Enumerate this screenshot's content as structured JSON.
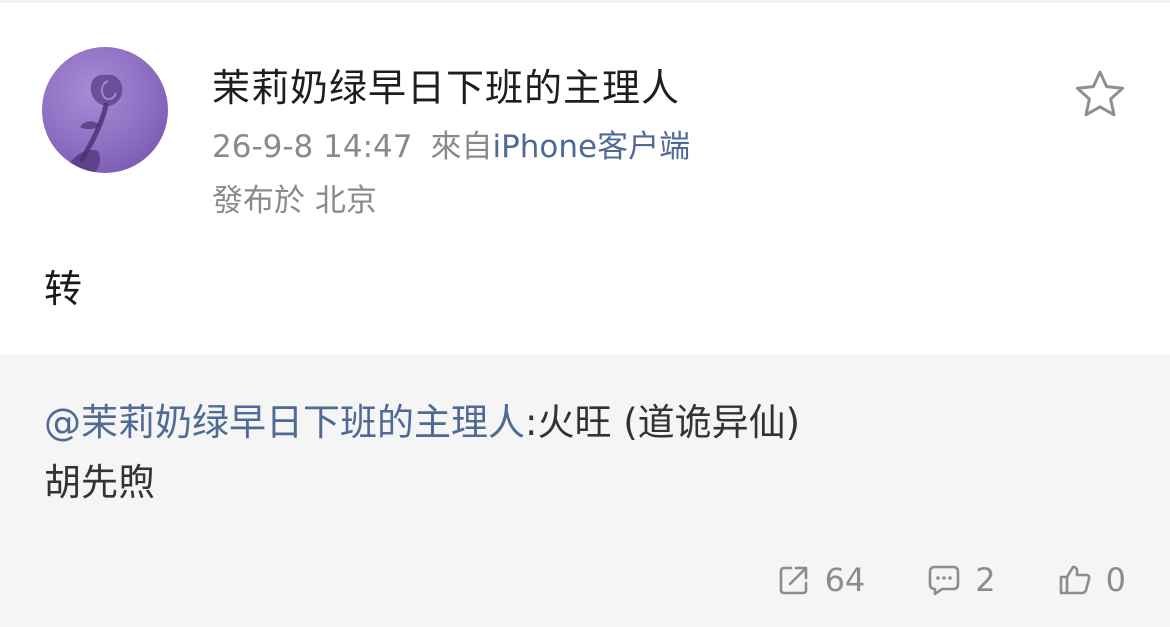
{
  "post": {
    "username": "茉莉奶绿早日下班的主理人",
    "time": "26-9-8 14:47",
    "source_prefix": "來自",
    "source_app": "iPhone客户端",
    "location": "發布於 北京",
    "text": "转"
  },
  "repost": {
    "mention": "@茉莉奶绿早日下班的主理人",
    "text": ":火旺 (道诡异仙)\n胡先煦",
    "stats": {
      "share_count": "64",
      "comment_count": "2",
      "like_count": "0"
    }
  },
  "icons": {
    "favorite": "star-outline-icon",
    "share": "share-icon",
    "comment": "comment-icon",
    "like": "thumbs-up-icon"
  },
  "colors": {
    "link": "#4f6a95",
    "meta_gray": "#8a8a8a",
    "repost_bg": "#f5f5f5",
    "avatar_purple": "#8c6cc0"
  }
}
